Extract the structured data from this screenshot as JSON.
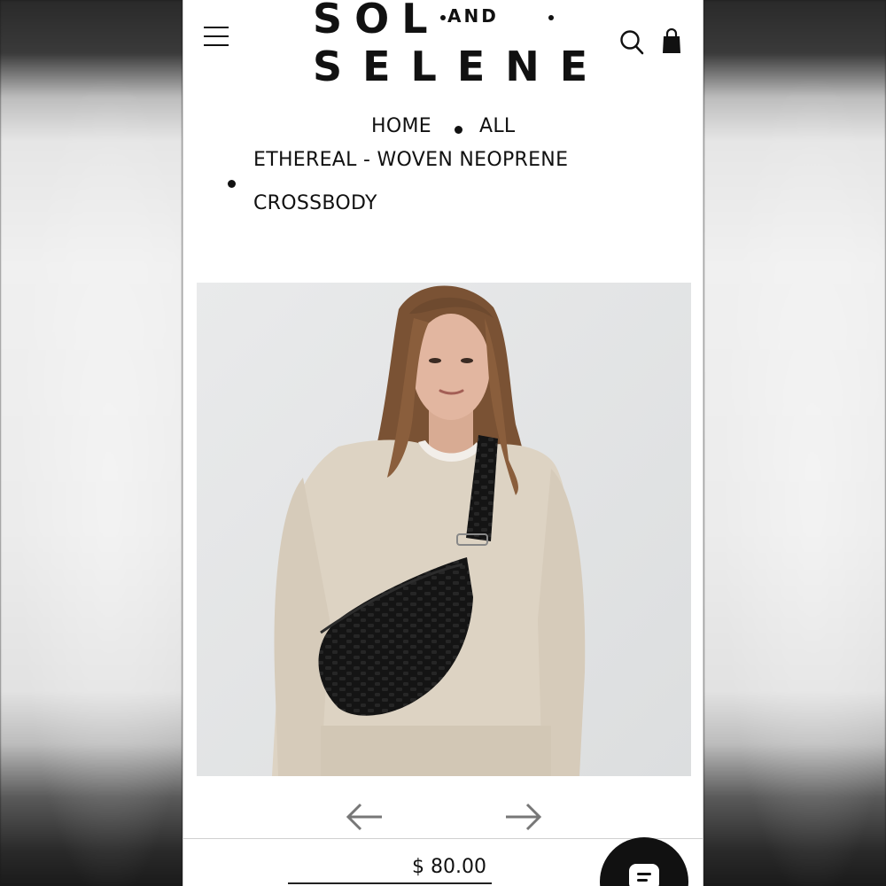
{
  "brand": {
    "line1": "SOL",
    "and": "AND",
    "line2": "SELENE"
  },
  "header": {
    "menu_icon": "hamburger-menu-icon",
    "search_icon": "search-icon",
    "cart_icon": "shopping-bag-icon"
  },
  "breadcrumb": {
    "home": "HOME",
    "all": "ALL",
    "current_line1": "ETHEREAL - WOVEN NEOPRENE",
    "current_line2": "CROSSBODY"
  },
  "product": {
    "image_icon": "model-wearing-black-woven-crossbody-photo",
    "prev_icon": "arrow-left-icon",
    "next_icon": "arrow-right-icon",
    "price": "$ 80.00"
  },
  "chat": {
    "icon": "chat-bubble-icon"
  },
  "colors": {
    "text": "#111111",
    "background": "#ffffff",
    "image_bg": "#e5e6e7",
    "sweater": "#ddd3c3",
    "bag": "#141414"
  }
}
